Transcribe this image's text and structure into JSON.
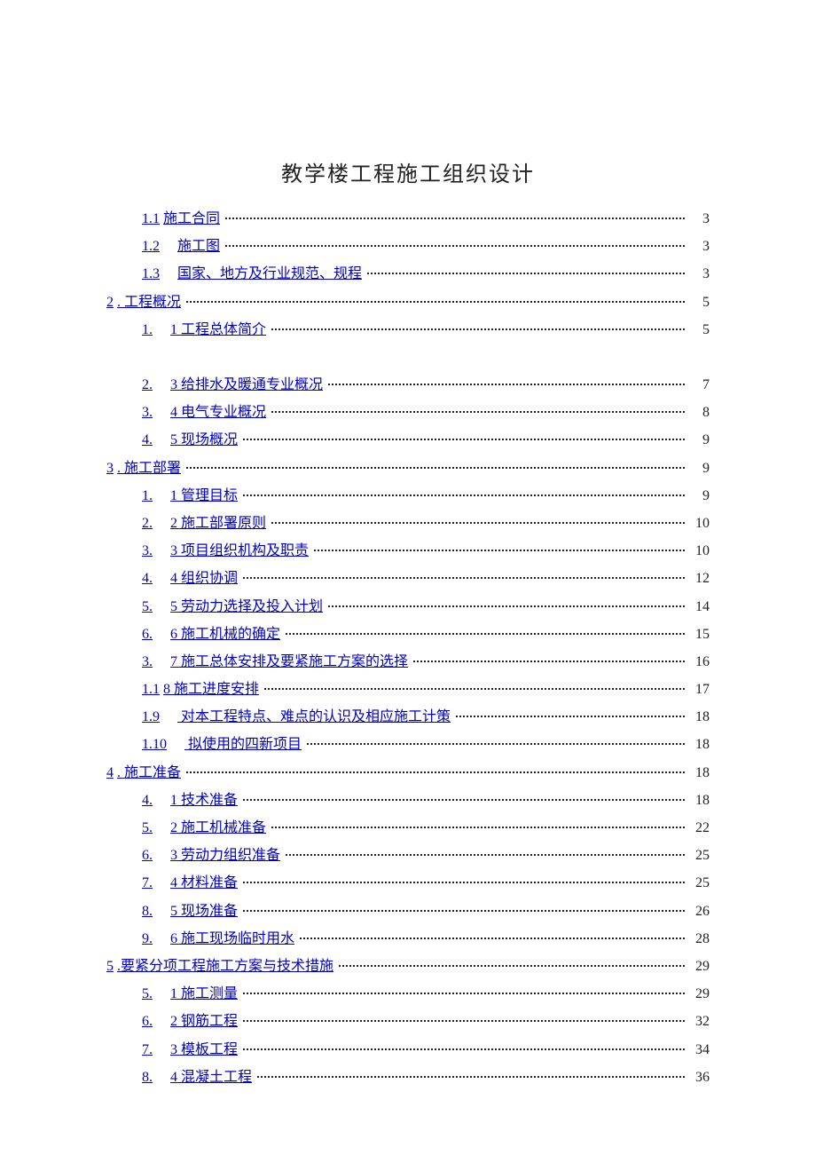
{
  "title": "教学楼工程施工组织设计",
  "toc": [
    {
      "level": 1,
      "prefix": "1.1",
      "gap": false,
      "text": "施工合同",
      "page": "3"
    },
    {
      "level": 1,
      "prefix": "1.2",
      "gap": true,
      "text": "施工图",
      "page": "3"
    },
    {
      "level": 1,
      "prefix": "1.3",
      "gap": true,
      "text": "国家、地方及行业规范、规程",
      "page": "3"
    },
    {
      "level": 0,
      "prefix": "2",
      "gap": false,
      "text": ". 工程概况",
      "page": "5"
    },
    {
      "level": 1,
      "prefix": "1.",
      "gap": true,
      "text": "1 工程总体简介",
      "page": "5"
    },
    {
      "level": 1,
      "blank": true
    },
    {
      "level": 1,
      "prefix": "2.",
      "gap": true,
      "text": "3 给排水及暖通专业概况",
      "page": "7"
    },
    {
      "level": 1,
      "prefix": "3.",
      "gap": true,
      "text": "4 电气专业概况",
      "page": "8"
    },
    {
      "level": 1,
      "prefix": "4.",
      "gap": true,
      "text": "5 现场概况",
      "page": "9"
    },
    {
      "level": 0,
      "prefix": "3",
      "gap": false,
      "text": ". 施工部署",
      "page": "9"
    },
    {
      "level": 1,
      "prefix": "1.",
      "gap": true,
      "text": "1 管理目标",
      "page": "9"
    },
    {
      "level": 1,
      "prefix": "2.",
      "gap": true,
      "text": "2 施工部署原则",
      "page": "10"
    },
    {
      "level": 1,
      "prefix": "3.",
      "gap": true,
      "text": "3 项目组织机构及职责",
      "page": "10"
    },
    {
      "level": 1,
      "prefix": "4.",
      "gap": true,
      "text": "4 组织协调",
      "page": "12"
    },
    {
      "level": 1,
      "prefix": "5.",
      "gap": true,
      "text": "5 劳动力选择及投入计划",
      "page": "14"
    },
    {
      "level": 1,
      "prefix": "6.",
      "gap": true,
      "text": "6 施工机械的确定",
      "page": "15"
    },
    {
      "level": 1,
      "prefix": "3.",
      "gap": true,
      "text": "7 施工总体安排及要紧施工方案的选择",
      "page": "16"
    },
    {
      "level": 1,
      "prefix": "1.1",
      "gap": false,
      "text": "8 施工进度安排",
      "page": "17"
    },
    {
      "level": 1,
      "prefix": "1.9",
      "gap": true,
      "text": "  对本工程特点、难点的认识及相应施工计策",
      "page": "18"
    },
    {
      "level": 1,
      "prefix": "1.10",
      "gap": true,
      "text": "  拟使用的四新项目",
      "page": "18"
    },
    {
      "level": 0,
      "prefix": "4",
      "gap": false,
      "text": ". 施工准备",
      "page": "18"
    },
    {
      "level": 1,
      "prefix": "4.",
      "gap": true,
      "text": "1 技术准备",
      "page": "18"
    },
    {
      "level": 1,
      "prefix": "5.",
      "gap": true,
      "text": "2 施工机械准备",
      "page": "22"
    },
    {
      "level": 1,
      "prefix": "6.",
      "gap": true,
      "text": "3 劳动力组织准备",
      "page": "25"
    },
    {
      "level": 1,
      "prefix": "7.",
      "gap": true,
      "text": "4 材料准备",
      "page": "25"
    },
    {
      "level": 1,
      "prefix": "8.",
      "gap": true,
      "text": "5 现场准备",
      "page": "26"
    },
    {
      "level": 1,
      "prefix": "9.",
      "gap": true,
      "text": "6 施工现场临时用水",
      "page": "28"
    },
    {
      "level": 0,
      "prefix": "5",
      "gap": false,
      "text": ".要紧分项工程施工方案与技术措施",
      "page": "29"
    },
    {
      "level": 1,
      "prefix": "5.",
      "gap": true,
      "text": "1 施工测量",
      "page": "29"
    },
    {
      "level": 1,
      "prefix": "6.",
      "gap": true,
      "text": "2 钢筋工程",
      "page": "32"
    },
    {
      "level": 1,
      "prefix": "7.",
      "gap": true,
      "text": "3 模板工程",
      "page": "34"
    },
    {
      "level": 1,
      "prefix": "8.",
      "gap": true,
      "text": "4 混凝土工程",
      "page": "36"
    }
  ]
}
